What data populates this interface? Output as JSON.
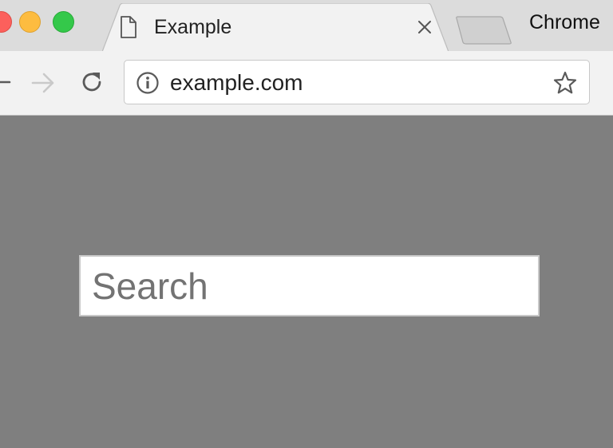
{
  "window": {
    "traffic_lights": [
      "close",
      "minimize",
      "maximize"
    ],
    "colors": {
      "close": "#fc605c",
      "minimize": "#fdbc40",
      "maximize": "#34c84a"
    }
  },
  "tabstrip": {
    "active_tab": {
      "icon": "page-icon",
      "title": "Example",
      "close_icon": "close-icon"
    },
    "new_tab_icon": "new-tab-icon",
    "app_label": "Chrome"
  },
  "toolbar": {
    "back_icon": "back-arrow-icon",
    "forward_icon": "forward-arrow-icon",
    "reload_icon": "reload-icon",
    "omnibox": {
      "security_icon": "info-icon",
      "url": "example.com",
      "bookmark_icon": "star-icon"
    }
  },
  "content": {
    "background": "#7f7f7f",
    "search": {
      "placeholder": "Search",
      "value": ""
    }
  }
}
